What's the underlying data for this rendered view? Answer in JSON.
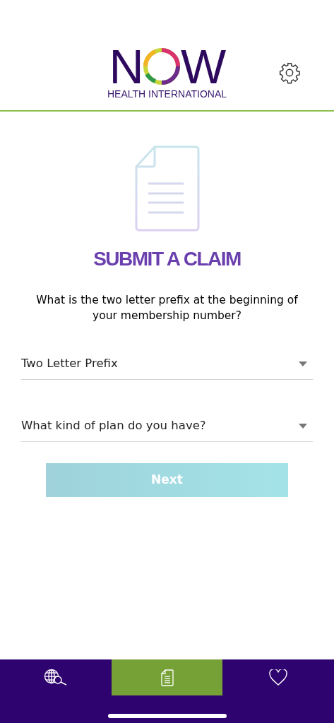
{
  "logo": {
    "before_ring": "N",
    "after_ring": "W",
    "subtitle": "HEALTH INTERNATIONAL"
  },
  "title": "SUBMIT A CLAIM",
  "question": "What is the two letter prefix at the beginning of your membership number?",
  "dropdowns": [
    {
      "placeholder": "Two Letter Prefix"
    },
    {
      "placeholder": "What kind of plan do you have?"
    }
  ],
  "next_button": {
    "label": "Next",
    "disabled": true
  },
  "nav": [
    {
      "kind": "globe-search",
      "selected": false
    },
    {
      "kind": "document",
      "selected": true
    },
    {
      "kind": "heart",
      "selected": false
    }
  ]
}
